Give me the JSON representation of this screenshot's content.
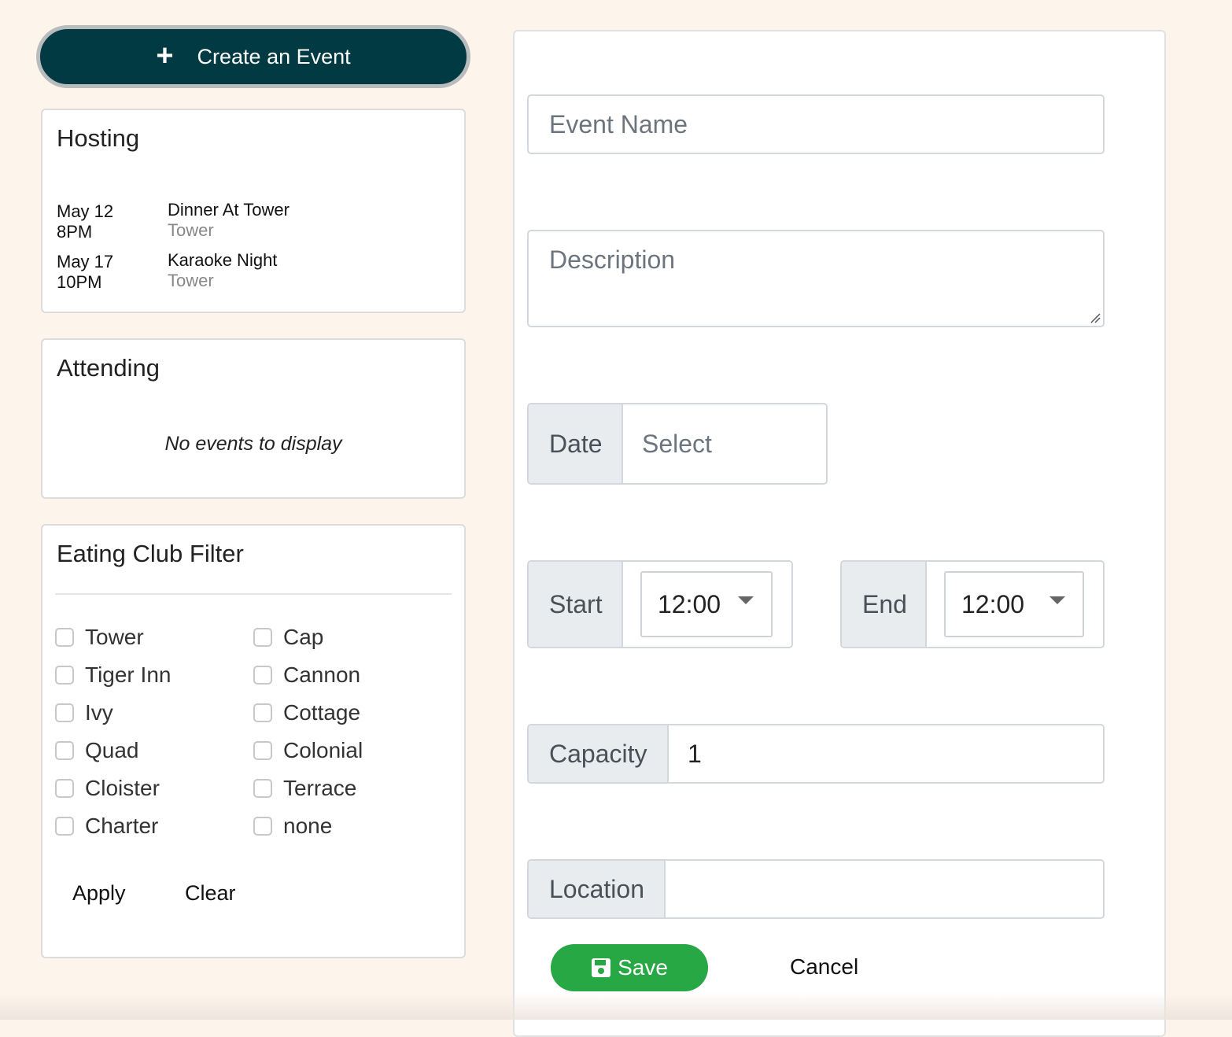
{
  "create_button": {
    "icon": "plus-icon",
    "label": "Create an Event"
  },
  "hosting": {
    "title": "Hosting",
    "events": [
      {
        "date": "May 12",
        "time": "8PM",
        "name": "Dinner At Tower",
        "location": "Tower"
      },
      {
        "date": "May 17",
        "time": "10PM",
        "name": "Karaoke Night",
        "location": "Tower"
      }
    ]
  },
  "attending": {
    "title": "Attending",
    "empty_text": "No events to display"
  },
  "filter": {
    "title": "Eating Club Filter",
    "options": [
      "Tower",
      "Cap",
      "Tiger Inn",
      "Cannon",
      "Ivy",
      "Cottage",
      "Quad",
      "Colonial",
      "Cloister",
      "Terrace",
      "Charter",
      "none"
    ],
    "apply_label": "Apply",
    "clear_label": "Clear"
  },
  "form": {
    "event_name_placeholder": "Event Name",
    "description_placeholder": "Description",
    "date_label": "Date",
    "date_placeholder": "Select",
    "start_label": "Start",
    "start_value": "12:00",
    "end_label": "End",
    "end_value": "12:00",
    "capacity_label": "Capacity",
    "capacity_value": "1",
    "location_label": "Location",
    "location_value": "",
    "save_label": "Save",
    "save_icon": "floppy-disk-icon",
    "cancel_label": "Cancel"
  },
  "colors": {
    "page_background": "#fdf4ec",
    "create_button": "#023a43",
    "save_button": "#28a745",
    "addon_background": "#e9ecef"
  }
}
